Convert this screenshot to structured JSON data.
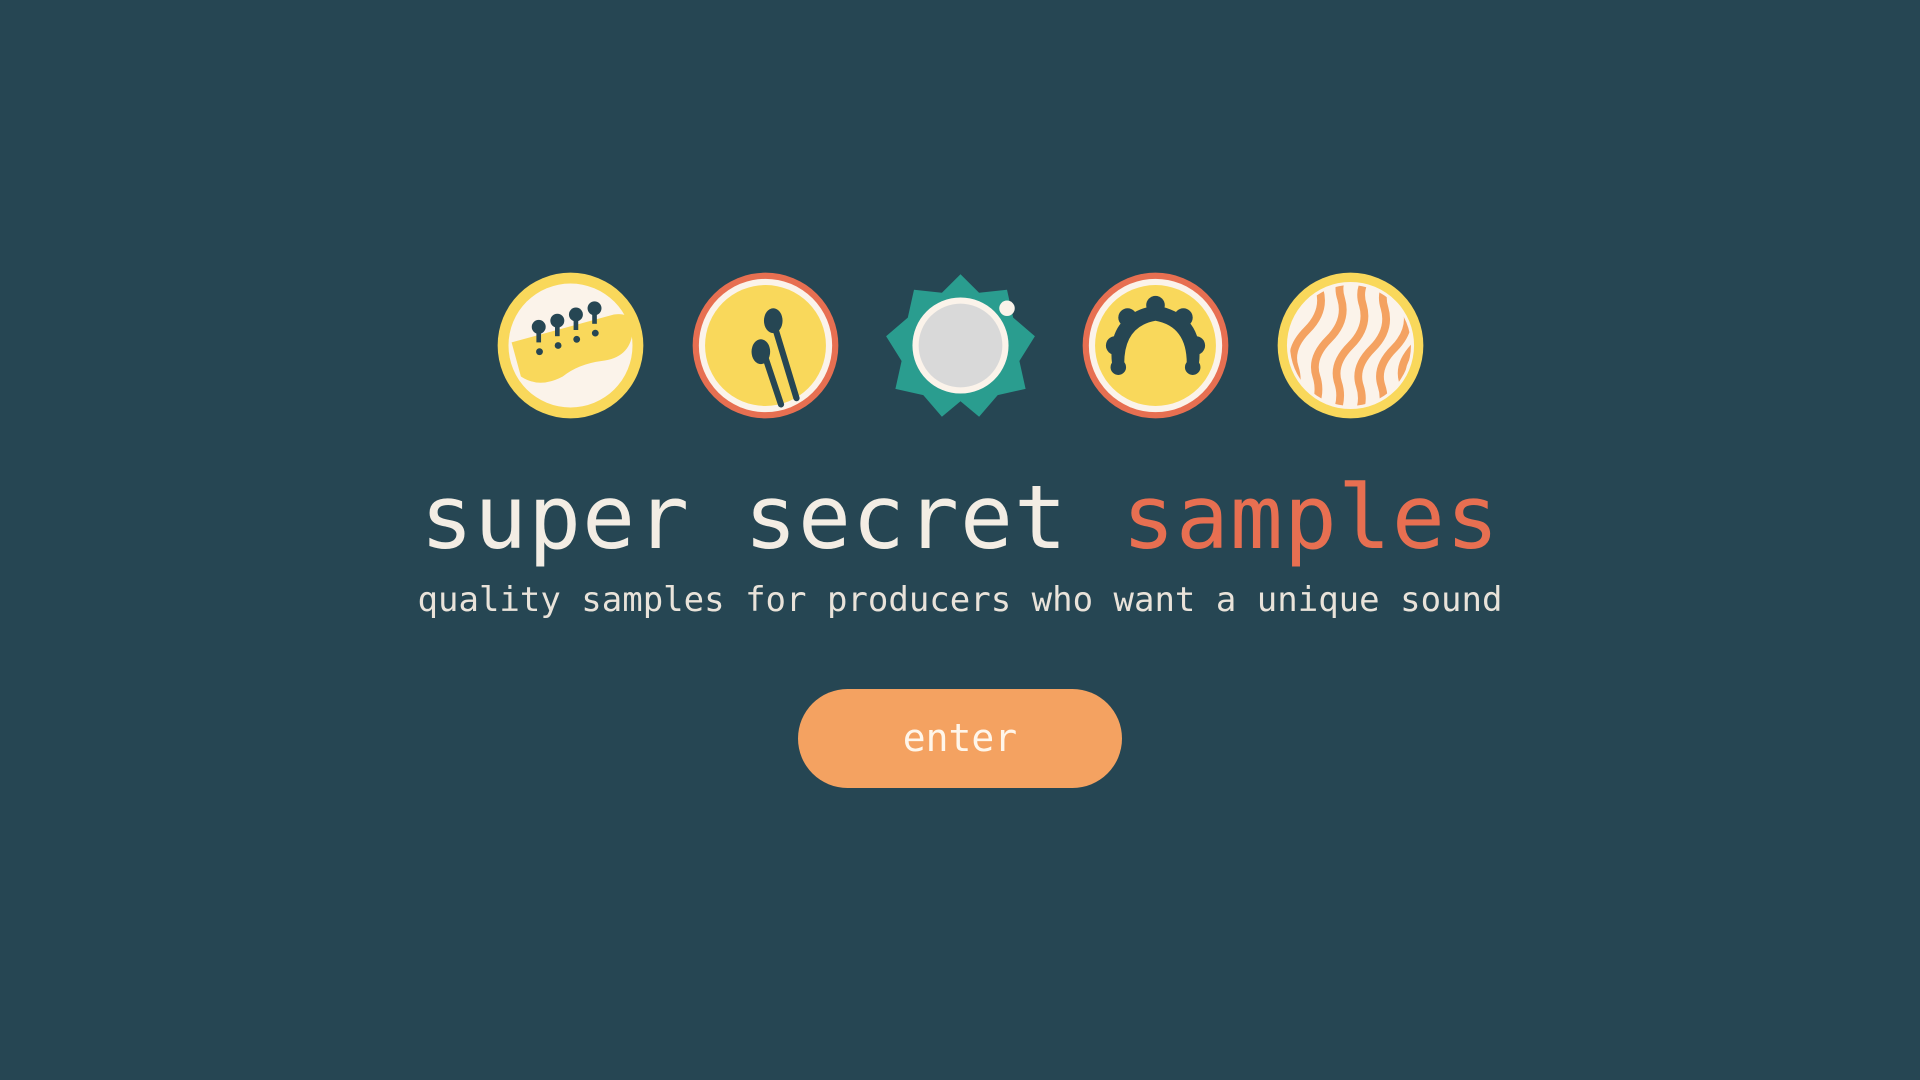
{
  "brand": {
    "title_part1": "super secret",
    "title_part2": "samples",
    "tagline": "quality samples for producers who want a unique sound"
  },
  "actions": {
    "enter_label": "enter"
  },
  "icons": [
    {
      "name": "bass-guitar-headstock-icon"
    },
    {
      "name": "drumsticks-icon"
    },
    {
      "name": "cymbal-icon"
    },
    {
      "name": "tambourine-icon"
    },
    {
      "name": "wave-texture-icon"
    }
  ],
  "colors": {
    "background": "#264653",
    "accent": "#e76f51",
    "button": "#f4a261",
    "yellow": "#f9d85b",
    "teal": "#2a9d8f",
    "cream": "#fbf3ea",
    "text": "#f3ede4"
  }
}
